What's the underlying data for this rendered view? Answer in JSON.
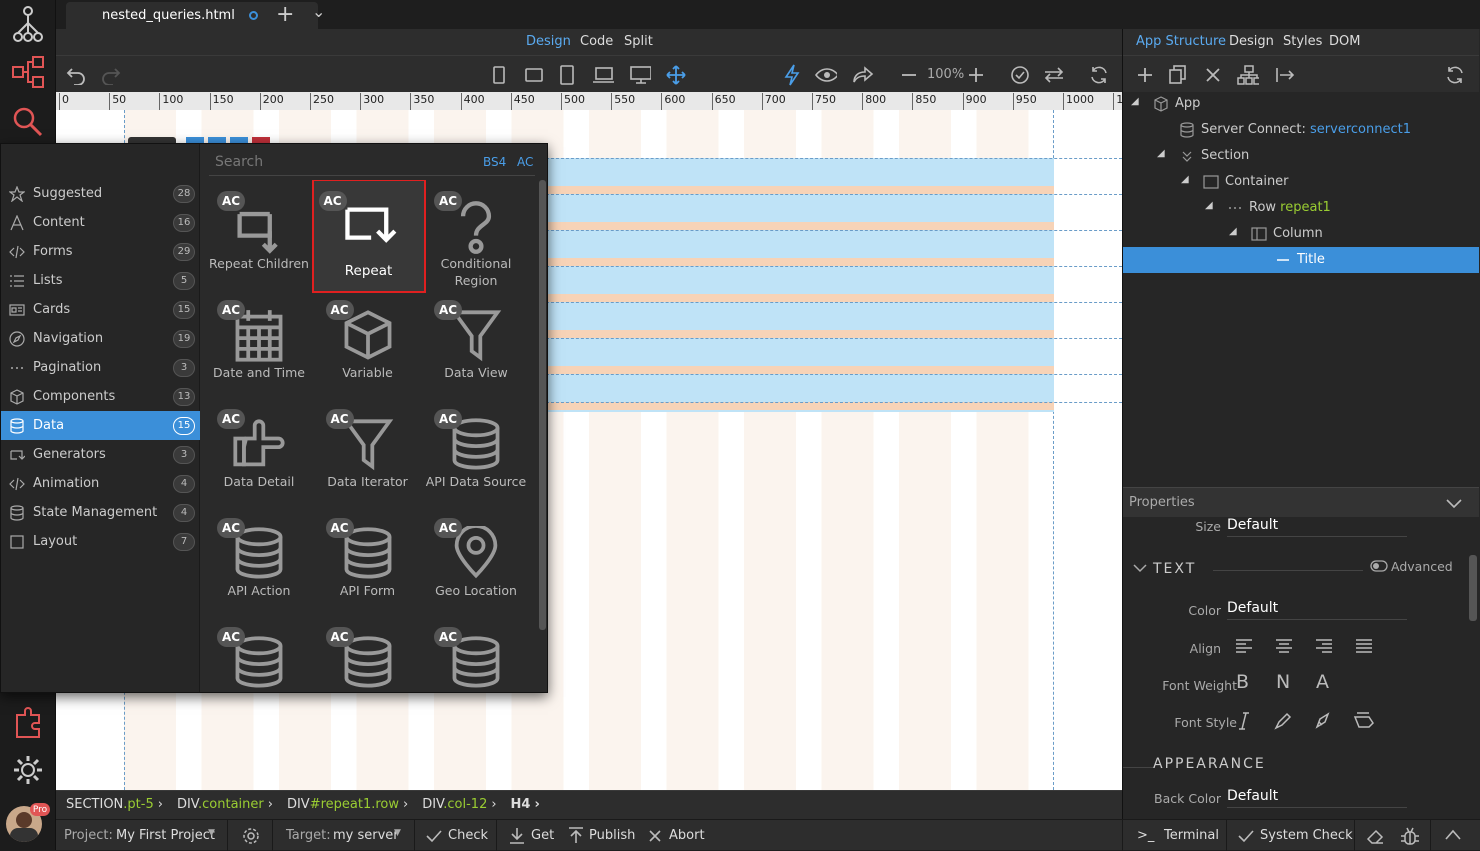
{
  "file_tab": {
    "name": "nested_queries.html",
    "add": "+",
    "menu": "⌄"
  },
  "view_tabs": [
    "Design",
    "Code",
    "Split"
  ],
  "toolbar": {
    "zoom": "100%"
  },
  "ruler": [
    "0",
    "50",
    "100",
    "150",
    "200",
    "250",
    "300",
    "350",
    "400",
    "450",
    "500",
    "550",
    "600",
    "650",
    "700",
    "750",
    "800",
    "850",
    "900",
    "950",
    "1000",
    "10"
  ],
  "right_tabs": [
    "App Structure",
    "Design",
    "Styles",
    "DOM"
  ],
  "tree": [
    {
      "label": "App",
      "value": "",
      "icon": "cube-icon"
    },
    {
      "label": "Server Connect: ",
      "value": "serverconnect1",
      "icon": "database-icon"
    },
    {
      "label": "Section",
      "value": "",
      "icon": "section-icon"
    },
    {
      "label": "Container",
      "value": "",
      "icon": "container-icon"
    },
    {
      "label": "Row ",
      "value": "repeat1",
      "icon": "row-icon"
    },
    {
      "label": "Column",
      "value": "",
      "icon": "column-icon"
    },
    {
      "label": "Title",
      "value": "",
      "icon": "title-icon"
    }
  ],
  "properties": {
    "header": "Properties",
    "size_label": "Size",
    "size_value": "Default",
    "text_section": "TEXT",
    "advanced": "Advanced",
    "color_label": "Color",
    "color_value": "Default",
    "align_label": "Align",
    "font_weight_label": "Font Weight",
    "fw_b": "B",
    "fw_n": "N",
    "fw_a": "A",
    "font_style_label": "Font Style",
    "appearance_section": "APPEARANCE",
    "back_color_label": "Back Color",
    "back_color_value": "Default"
  },
  "popup": {
    "search_placeholder": "Search",
    "bs4": "BS4",
    "ac": "AC",
    "categories": [
      {
        "label": "Suggested",
        "count": "28",
        "icon": "star-icon"
      },
      {
        "label": "Content",
        "count": "16",
        "icon": "font-icon"
      },
      {
        "label": "Forms",
        "count": "29",
        "icon": "code-icon"
      },
      {
        "label": "Lists",
        "count": "5",
        "icon": "list-icon"
      },
      {
        "label": "Cards",
        "count": "15",
        "icon": "card-icon"
      },
      {
        "label": "Navigation",
        "count": "19",
        "icon": "compass-icon"
      },
      {
        "label": "Pagination",
        "count": "3",
        "icon": "ellipsis-icon"
      },
      {
        "label": "Components",
        "count": "13",
        "icon": "cube-icon"
      },
      {
        "label": "Data",
        "count": "15",
        "icon": "database-icon"
      },
      {
        "label": "Generators",
        "count": "3",
        "icon": "repeat-icon"
      },
      {
        "label": "Animation",
        "count": "4",
        "icon": "code-icon"
      },
      {
        "label": "State Management",
        "count": "4",
        "icon": "database-icon"
      },
      {
        "label": "Layout",
        "count": "7",
        "icon": "square-icon"
      }
    ],
    "items": [
      {
        "label": "Repeat Children",
        "icon": "repeat-children-icon"
      },
      {
        "label": "Repeat",
        "icon": "repeat-icon"
      },
      {
        "label": "Conditional Region",
        "icon": "question-icon"
      },
      {
        "label": "Date and Time",
        "icon": "calendar-icon"
      },
      {
        "label": "Variable",
        "icon": "cube-icon"
      },
      {
        "label": "Data View",
        "icon": "filter-icon"
      },
      {
        "label": "Data Detail",
        "icon": "hand-pointer-icon"
      },
      {
        "label": "Data Iterator",
        "icon": "filter-icon"
      },
      {
        "label": "API Data Source",
        "icon": "database-icon"
      },
      {
        "label": "API Action",
        "icon": "database-icon"
      },
      {
        "label": "API Form",
        "icon": "database-icon"
      },
      {
        "label": "Geo Location",
        "icon": "map-marker-icon"
      },
      {
        "label": "",
        "icon": "database-icon"
      },
      {
        "label": "",
        "icon": "database-icon"
      },
      {
        "label": "",
        "icon": "database-icon"
      }
    ],
    "ac_badge": "AC"
  },
  "breadcrumb": [
    {
      "tag": "SECTION",
      "suffix": ".pt-5"
    },
    {
      "tag": "DIV",
      "suffix": ".container"
    },
    {
      "tag": "DIV",
      "suffix": "#repeat1.row"
    },
    {
      "tag": "DIV",
      "suffix": ".col-12"
    },
    {
      "tag": "H4",
      "suffix": ""
    }
  ],
  "bottom": {
    "project_label": "Project:",
    "project_value": "My First Project",
    "target_label": "Target:",
    "target_value": "my server",
    "check": "Check",
    "get": "Get",
    "publish": "Publish",
    "abort": "Abort",
    "terminal": "Terminal",
    "system_check": "System Check"
  },
  "avatar_badge": "Pro"
}
